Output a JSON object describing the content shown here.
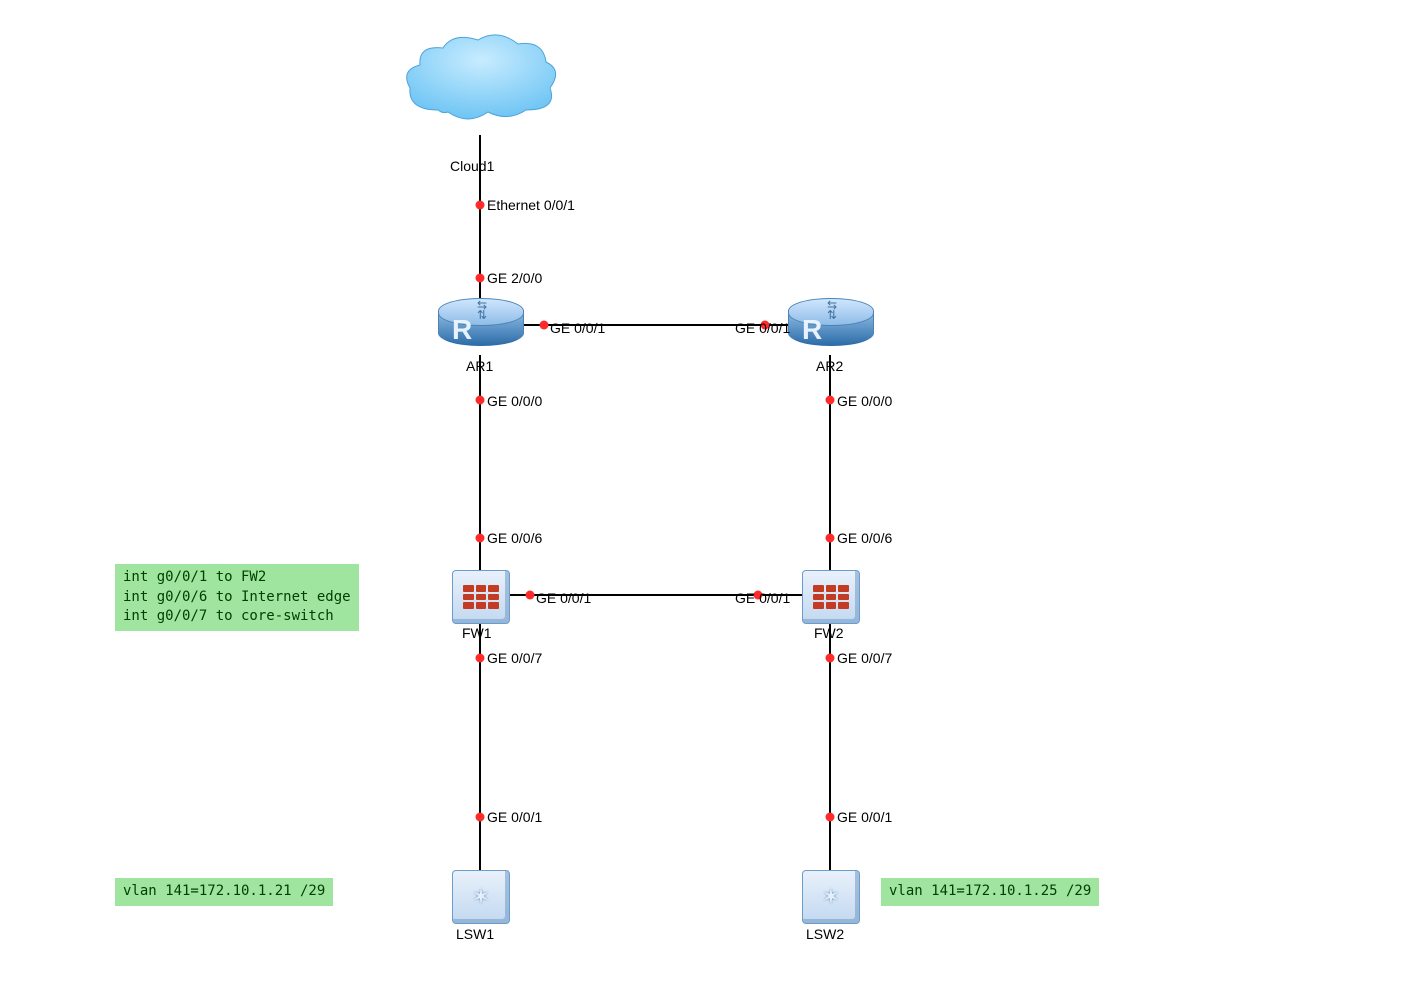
{
  "nodes": {
    "cloud": {
      "label": "Cloud1"
    },
    "ar1": {
      "label": "AR1"
    },
    "ar2": {
      "label": "AR2"
    },
    "fw1": {
      "label": "FW1"
    },
    "fw2": {
      "label": "FW2"
    },
    "lsw1": {
      "label": "LSW1"
    },
    "lsw2": {
      "label": "LSW2"
    }
  },
  "ports": {
    "cloud_eth": "Ethernet 0/0/1",
    "ar1_ge2": "GE 2/0/0",
    "ar1_ge0_1": "GE 0/0/1",
    "ar2_ge0_1": "GE 0/0/1",
    "ar1_ge0_0": "GE 0/0/0",
    "ar2_ge0_0": "GE 0/0/0",
    "fw1_ge6": "GE 0/0/6",
    "fw2_ge6": "GE 0/0/6",
    "fw1_ge1": "GE 0/0/1",
    "fw2_ge1": "GE 0/0/1",
    "fw1_ge7": "GE 0/0/7",
    "fw2_ge7": "GE 0/0/7",
    "lsw1_ge1": "GE 0/0/1",
    "lsw2_ge1": "GE 0/0/1"
  },
  "notes": {
    "fw_ports": "int g0/0/1 to FW2\nint g0/0/6 to Internet edge\nint g0/0/7 to core-switch",
    "vlan_lsw1": "vlan 141=172.10.1.21 /29",
    "vlan_lsw2": "vlan 141=172.10.1.25 /29"
  }
}
